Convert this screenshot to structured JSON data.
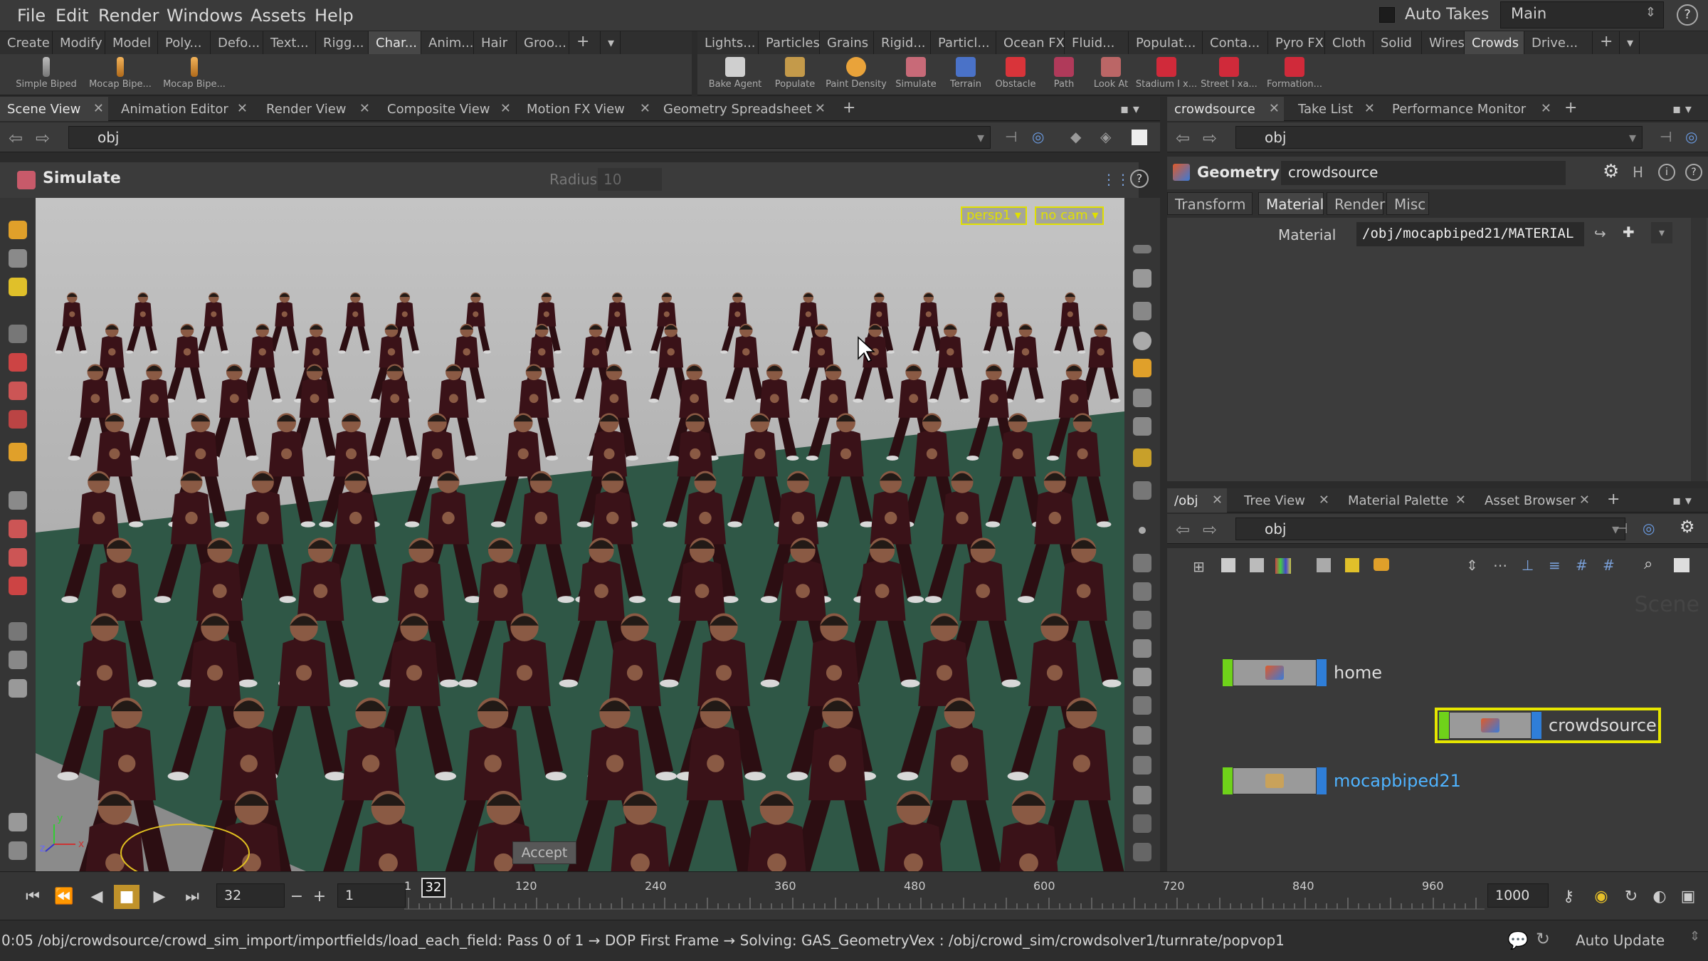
{
  "menu": [
    "File",
    "Edit",
    "Render",
    "Windows",
    "Assets",
    "Help"
  ],
  "auto_takes": "Auto Takes",
  "desktop": "Main",
  "help_icon": "?",
  "shelf_left": {
    "tabs": [
      "Create",
      "Modify",
      "Model",
      "Poly...",
      "Defo...",
      "Text...",
      "Rigg...",
      "Char...",
      "Anim...",
      "Hair",
      "Groo..."
    ],
    "active": "Char...",
    "tools": [
      "Simple Biped",
      "Mocap Bipe...",
      "Mocap Bipe..."
    ]
  },
  "shelf_right": {
    "tabs": [
      "Lights...",
      "Particles",
      "Grains",
      "Rigid...",
      "Particl...",
      "Ocean FX",
      "Fluid...",
      "Populat...",
      "Conta...",
      "Pyro FX",
      "Cloth",
      "Solid",
      "Wires",
      "Crowds",
      "Drive..."
    ],
    "active": "Crowds",
    "tools": [
      "Bake Agent",
      "Populate",
      "Paint Density",
      "Simulate",
      "Terrain",
      "Obstacle",
      "Path",
      "Look At",
      "Stadium I x...",
      "Street I xa...",
      "Formation..."
    ]
  },
  "left_pane_tabs": [
    "Scene View",
    "Animation Editor",
    "Render View",
    "Composite View",
    "Motion FX View",
    "Geometry Spreadsheet"
  ],
  "left_path": "obj",
  "viewport": {
    "tool_name": "Simulate",
    "radius_label": "Radius",
    "radius_value": "10",
    "camera": "persp1",
    "cam_mode": "no cam",
    "accept": "Accept",
    "axis_y": "y",
    "axis_x": "x",
    "axis_z": "z"
  },
  "param_tabs_top": [
    "crowdsource",
    "Take List",
    "Performance Monitor"
  ],
  "param_path": "obj",
  "param": {
    "type": "Geometry",
    "node_name": "crowdsource",
    "tabs": [
      "Transform",
      "Material",
      "Render",
      "Misc"
    ],
    "active_tab": "Material",
    "material_label": "Material",
    "material_value": "/obj/mocapbiped21/MATERIAL"
  },
  "net_tabs": [
    "/obj",
    "Tree View",
    "Material Palette",
    "Asset Browser"
  ],
  "net_path": "obj",
  "net_watermark": "Scene",
  "nodes": [
    {
      "name": "home",
      "selected": false,
      "label_color": "#dcdcdc"
    },
    {
      "name": "crowdsource",
      "selected": true,
      "label_color": "#dcdcdc"
    },
    {
      "name": "mocapbiped21",
      "selected": false,
      "label_color": "#4fb3ff"
    }
  ],
  "timeline": {
    "current_frame": "32",
    "step": "1",
    "marker": "32",
    "start_tick": "1",
    "ticks": [
      "120",
      "240",
      "360",
      "480",
      "600",
      "720",
      "840",
      "960"
    ],
    "end_frame": "1000"
  },
  "status": {
    "message": "0:05 /obj/crowdsource/crowd_sim_import/importfields/load_each_field: Pass 0 of 1 → DOP First Frame → Solving: GAS_GeometryVex : /obj/crowd_sim/crowdsolver1/turnrate/popvop1",
    "auto_update": "Auto Update"
  },
  "colors": {
    "selection": "#e6e600",
    "node_blue": "#2f7ed8",
    "node_green": "#6fd21a",
    "ground": "#2f5746",
    "agent": "#3a1218"
  }
}
